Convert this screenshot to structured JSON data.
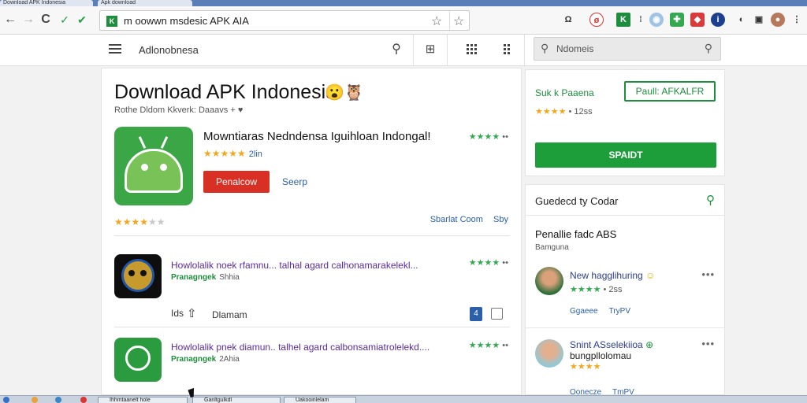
{
  "browser": {
    "tabs": [
      {
        "label": "Download APK Indonesia"
      },
      {
        "label": "Apk download"
      }
    ],
    "url": "m oowwn msdesic APK AIA",
    "back_glyph": "←",
    "forward_glyph": "→",
    "reload_glyph": "C"
  },
  "site": {
    "title": "Adlonobnesa",
    "search_placeholder": "Ndomeis"
  },
  "main": {
    "page_title": "Download APK Indonesia",
    "subline": "Rothe Dldom Kkverk: Daaavs",
    "featured": {
      "name": "Mowntiaras Nedndensa Iguihloan Indongal!",
      "rating_count": "2lin",
      "download_label": "Penalcow",
      "search_label": "Seerp",
      "link1": "Sbarlat Coom",
      "link2": "Sby"
    },
    "list": [
      {
        "title": "Howlolalik noek rfamnu... talhal agard calhonamarakelekl...",
        "developer": "Pranagngek",
        "meta": "Shhia"
      },
      {
        "title": "Howlolalik pnek diamun.. talhel agard calbonsamiatrolelekd....",
        "developer": "Pranagngek",
        "meta": "2Ahia"
      }
    ],
    "actions": {
      "label1": "Ids",
      "label2": "Dlamam",
      "badge": "4"
    }
  },
  "sidebar": {
    "promo": {
      "title": "Suk k Paaena",
      "outline_button": "Paull: AFKALFR",
      "rating_count": "12ss",
      "green_button": "SPAIDT"
    },
    "section": {
      "header": "Guedecd ty Codar",
      "title": "Penallie fadc ABS",
      "subtitle": "Bamguna",
      "items": [
        {
          "name": "New hagglihuring",
          "rating_count": "2ss",
          "link1": "Ggaeee",
          "link2": "TryPV"
        },
        {
          "name": "Snint ASselekiioa",
          "name2": "bungpllolomau",
          "link1": "Oonecze",
          "link2": "TmPV"
        }
      ]
    }
  },
  "taskbar": {
    "tasks": [
      {
        "label": "Ihhmtaanelt hole"
      },
      {
        "label": "Ganltgulkdl"
      },
      {
        "label": "Uakooinlelam"
      }
    ]
  },
  "colors": {
    "accent_green": "#1e9e3a",
    "download_red": "#d93025",
    "link_blue": "#2b5fa8",
    "star_gold": "#f2a71c"
  }
}
